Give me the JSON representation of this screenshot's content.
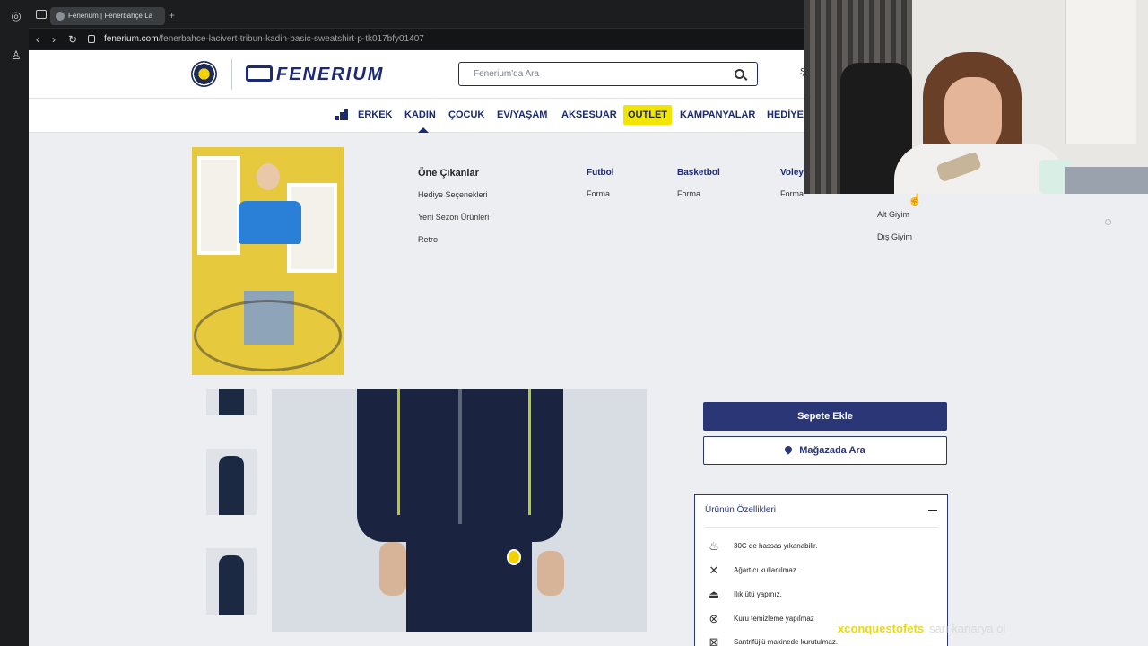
{
  "browser": {
    "tab_title": "Fenerium | Fenerbahçe La",
    "new_tab": "+",
    "url_domain": "fenerium.com",
    "url_path": "/fenerbahce-lacivert-tribun-kadin-basic-sweatshirt-p-tk017bfy01407"
  },
  "header": {
    "logo_text": "FENERIUM",
    "search_placeholder": "Fenerium'da Ara",
    "extra": "Ş"
  },
  "nav": {
    "items": [
      "ERKEK",
      "KADIN",
      "ÇOCUK",
      "EV/YAŞAM",
      "AKSESUAR",
      "OUTLET",
      "KAMPANYALAR",
      "HEDİYE"
    ]
  },
  "mega_menu": {
    "featured": {
      "title": "Öne Çıkanlar",
      "links": [
        "Hediye Seçenekleri",
        "Yeni Sezon Ürünleri",
        "Retro"
      ]
    },
    "columns": [
      {
        "title": "Futbol",
        "links": [
          "Forma"
        ]
      },
      {
        "title": "Basketbol",
        "links": [
          "Forma"
        ]
      },
      {
        "title": "Voleyb",
        "links": [
          "Forma"
        ]
      }
    ],
    "extra_links": [
      "Alt Giyim",
      "Dış Giyim"
    ]
  },
  "product": {
    "add_to_cart": "Sepete Ekle",
    "find_in_store": "Mağazada Ara",
    "features_title": "Ürünün Özellikleri",
    "care": [
      {
        "icon": "wash-30-icon",
        "text": "30C de hassas yıkanabilir."
      },
      {
        "icon": "no-bleach-icon",
        "text": "Ağartıcı kullanılmaz."
      },
      {
        "icon": "iron-low-icon",
        "text": "Ilık ütü yapınız."
      },
      {
        "icon": "no-dry-clean-icon",
        "text": "Kuru temizleme yapılmaz"
      },
      {
        "icon": "no-tumble-dry-icon",
        "text": "Santrifüjlü makinede kurutulmaz."
      }
    ]
  },
  "overlay": {
    "watermark_name": "xconquestofets",
    "watermark_tag": "sarı kanarya ol"
  },
  "colors": {
    "brand_navy": "#1b2a72",
    "button_navy": "#2a3676",
    "outlet_yellow": "#f2e600"
  }
}
